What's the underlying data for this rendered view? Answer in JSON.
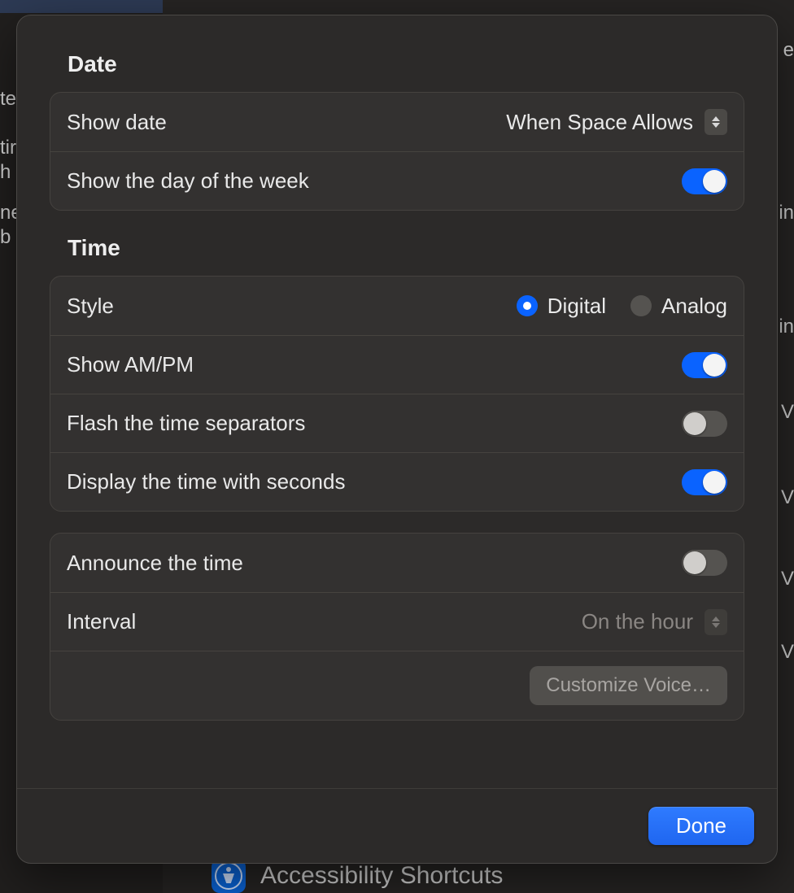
{
  "sections": {
    "date": {
      "title": "Date",
      "show_date": {
        "label": "Show date",
        "value": "When Space Allows"
      },
      "show_day_of_week": {
        "label": "Show the day of the week",
        "on": true
      }
    },
    "time": {
      "title": "Time",
      "style": {
        "label": "Style",
        "options": {
          "digital": "Digital",
          "analog": "Analog"
        },
        "selected": "digital"
      },
      "show_ampm": {
        "label": "Show AM/PM",
        "on": true
      },
      "flash_separators": {
        "label": "Flash the time separators",
        "on": false
      },
      "display_seconds": {
        "label": "Display the time with seconds",
        "on": true
      },
      "announce_time": {
        "label": "Announce the time",
        "on": false
      },
      "interval": {
        "label": "Interval",
        "value": "On the hour",
        "enabled": false
      },
      "customize_voice": {
        "label": "Customize Voice…",
        "enabled": false
      }
    }
  },
  "footer": {
    "done": "Done"
  },
  "background": {
    "bottom_label": "Accessibility Shortcuts",
    "right_hints": [
      "e",
      "in",
      "in",
      "V",
      "V",
      "V",
      "V"
    ],
    "left_hints": [
      "te",
      "tir",
      "h",
      "ne",
      "b"
    ]
  }
}
